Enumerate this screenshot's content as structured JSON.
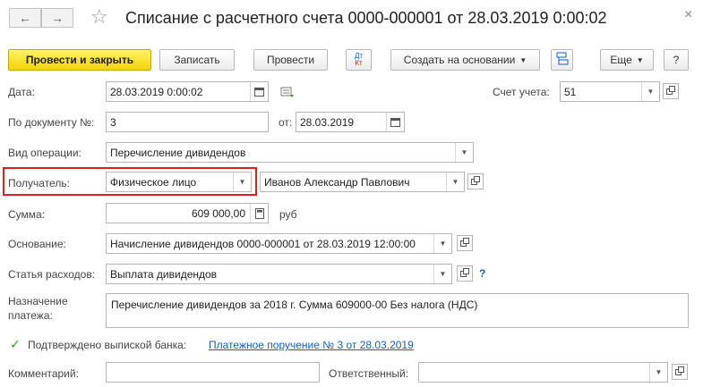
{
  "window": {
    "title": "Списание с расчетного счета 0000-000001 от 28.03.2019 0:00:02",
    "close_glyph": "×"
  },
  "nav": {
    "back": "←",
    "forward": "→",
    "star": "☆"
  },
  "toolbar": {
    "post_close": "Провести и закрыть",
    "save": "Записать",
    "post": "Провести",
    "dtkt_top": "Дт",
    "dtkt_bottom": "Кт",
    "create_based": "Создать на основании",
    "more": "Еще",
    "help": "?"
  },
  "form": {
    "date": {
      "label": "Дата:",
      "value": "28.03.2019  0:00:02"
    },
    "account": {
      "label": "Счет учета:",
      "value": "51"
    },
    "doc_number": {
      "label": "По документу №:",
      "value": "3"
    },
    "doc_date": {
      "label": "от:",
      "value": "28.03.2019"
    },
    "operation": {
      "label": "Вид операции:",
      "value": "Перечисление дивидендов"
    },
    "recipient": {
      "label": "Получатель:",
      "type_value": "Физическое лицо",
      "value": "Иванов Александр Павлович"
    },
    "amount": {
      "label": "Сумма:",
      "value": "609 000,00",
      "currency": "руб"
    },
    "basis": {
      "label": "Основание:",
      "value": "Начисление дивидендов 0000-000001 от 28.03.2019 12:00:00"
    },
    "expense": {
      "label": "Статья расходов:",
      "value": "Выплата дивидендов",
      "help": "?"
    },
    "purpose": {
      "label_line1": "Назначение",
      "label_line2": "платежа:",
      "value": "Перечисление дивидендов за 2018 г. Сумма 609000-00 Без налога (НДС)"
    },
    "bank_confirmed": {
      "label": "Подтверждено выпиской банка:",
      "checked": true,
      "link": "Платежное поручение № 3 от 28.03.2019"
    },
    "comment": {
      "label": "Комментарий:",
      "value": ""
    },
    "responsible": {
      "label": "Ответственный:",
      "value": ""
    }
  },
  "colors": {
    "primary": "#f3d400",
    "highlight": "#e02020",
    "link": "#1a5fb4",
    "check": "#2e9a2e"
  }
}
